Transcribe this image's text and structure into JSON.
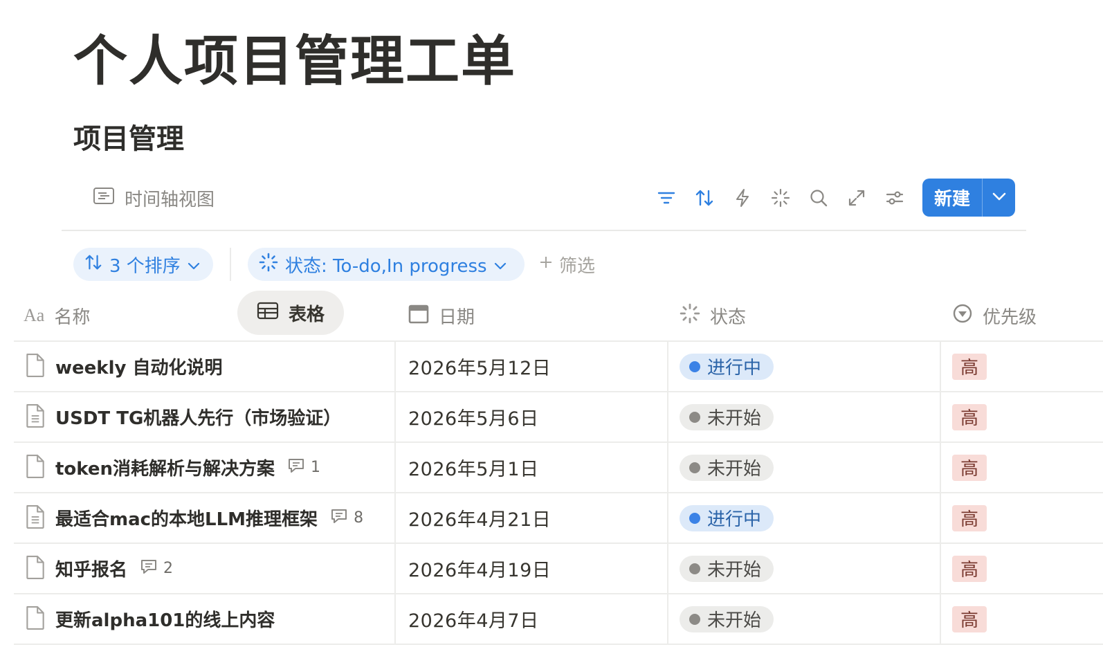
{
  "page": {
    "title": "个人项目管理工单"
  },
  "database": {
    "title": "项目管理"
  },
  "views": [
    {
      "label": "时间轴视图",
      "icon": "timeline-icon"
    },
    {
      "label": "表格",
      "icon": "table-icon"
    }
  ],
  "toolbar": {
    "icons": [
      "filter-icon",
      "sort-icon",
      "automation-icon",
      "ai-sparkle-icon",
      "search-icon",
      "expand-icon",
      "settings-sliders-icon"
    ],
    "new_label": "新建"
  },
  "filters": {
    "sort_chip": "3 个排序",
    "status_chip": "状态: To-do,In progress",
    "add_filter": "筛选"
  },
  "columns": {
    "name": "名称",
    "date": "日期",
    "status": "状态",
    "priority": "优先级"
  },
  "colors": {
    "accent": "#2f80e0",
    "status_in_progress_bg": "#dce9f9",
    "status_in_progress_text": "#2a63a8",
    "status_in_progress_dot": "#3b82e6",
    "status_not_started_bg": "#ececea",
    "status_not_started_text": "#4b4a47",
    "status_not_started_dot": "#8c8a86",
    "priority_high_bg": "#f8dcd8",
    "priority_high_text": "#7a3a30"
  },
  "rows": [
    {
      "name": "weekly 自动化说明",
      "doc_icon": "page-icon",
      "comments": "",
      "date": "2026年5月12日",
      "status": "进行中",
      "status_kind": "in_progress",
      "priority": "高"
    },
    {
      "name": "USDT TG机器人先行（市场验证）",
      "doc_icon": "page-text-icon",
      "comments": "",
      "date": "2026年5月6日",
      "status": "未开始",
      "status_kind": "not_started",
      "priority": "高"
    },
    {
      "name": "token消耗解析与解决方案",
      "doc_icon": "page-icon",
      "comments": "1",
      "date": "2026年5月1日",
      "status": "未开始",
      "status_kind": "not_started",
      "priority": "高"
    },
    {
      "name": "最适合mac的本地LLM推理框架",
      "doc_icon": "page-text-icon",
      "comments": "8",
      "date": "2026年4月21日",
      "status": "进行中",
      "status_kind": "in_progress",
      "priority": "高"
    },
    {
      "name": "知乎报名",
      "doc_icon": "page-icon",
      "comments": "2",
      "date": "2026年4月19日",
      "status": "未开始",
      "status_kind": "not_started",
      "priority": "高"
    },
    {
      "name": "更新alpha101的线上内容",
      "doc_icon": "page-icon",
      "comments": "",
      "date": "2026年4月7日",
      "status": "未开始",
      "status_kind": "not_started",
      "priority": "高"
    }
  ]
}
